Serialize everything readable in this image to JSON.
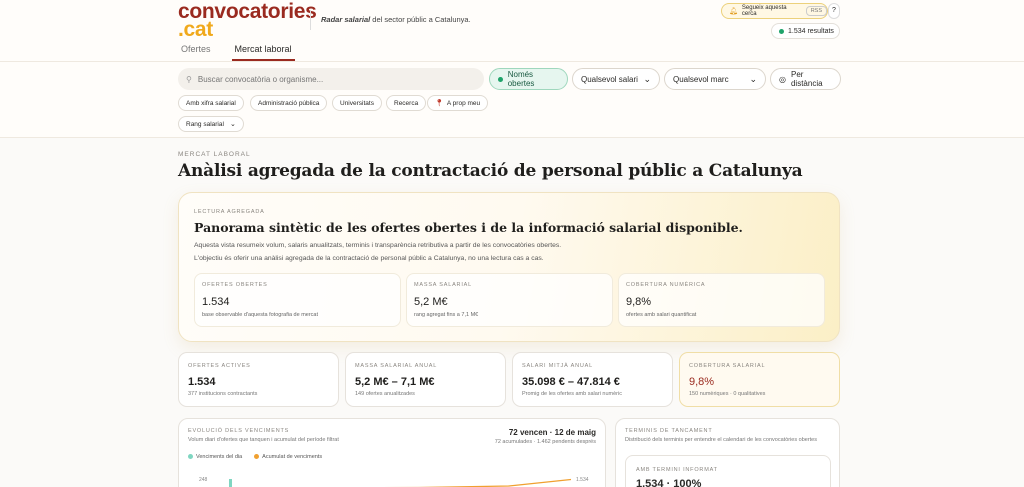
{
  "header": {
    "logo_top": "convocatories",
    "logo_bottom": ".cat",
    "tagline_bold": "Radar salarial",
    "tagline_rest": " del sector públic a Catalunya.",
    "tabs": [
      {
        "label": "Ofertes"
      },
      {
        "label": "Mercat laboral"
      }
    ],
    "follow_label": "Segueix aquesta cerca",
    "rss_label": "RSS",
    "help_label": "?",
    "results_label": "1.534 resultats"
  },
  "filters": {
    "search_placeholder": "Buscar convocatòria o organisme...",
    "only_open": "Només obertes",
    "salary_select": "Qualsevol salari",
    "mark_select": "Qualsevol marc",
    "distance": "Per distància",
    "chips": [
      "Amb xifra salarial",
      "Administració pública",
      "Universitats",
      "Recerca",
      "A prop meu"
    ],
    "salary_range": "Rang salarial"
  },
  "main": {
    "kicker": "MERCAT LABORAL",
    "title": "Anàlisi agregada de la contractació de personal públic a Catalunya"
  },
  "hero": {
    "kicker": "LECTURA AGREGADA",
    "title": "Panorama sintètic de les ofertes obertes i de la informació salarial disponible.",
    "desc1": "Aquesta vista resumeix volum, salaris anualitzats, terminis i transparència retributiva a partir de les convocatòries obertes.",
    "desc2": "L'objectiu és oferir una anàlisi agregada de la contractació de personal públic a Catalunya, no una lectura cas a cas.",
    "metrics": [
      {
        "label": "OFERTES OBERTES",
        "value": "1.534",
        "sub": "base observable d'aquesta fotografia de mercat"
      },
      {
        "label": "MASSA SALARIAL",
        "value": "5,2 M€",
        "sub": "rang agregat fins a 7,1 M€"
      },
      {
        "label": "COBERTURA NUMÈRICA",
        "value": "9,8%",
        "sub": "ofertes amb salari quantificat"
      }
    ]
  },
  "cards": [
    {
      "label": "OFERTES ACTIVES",
      "value": "1.534",
      "sub": "377 institucions contractants"
    },
    {
      "label": "MASSA SALARIAL ANUAL",
      "value": "5,2 M€ – 7,1 M€",
      "sub": "149 ofertes anualitzades"
    },
    {
      "label": "SALARI MITJÀ ANUAL",
      "value": "35.098 € – 47.814 €",
      "sub": "Promig de les ofertes amb salari numèric"
    },
    {
      "label": "COBERTURA SALARIAL",
      "value": "9,8%",
      "sub": "150 numèriques · 0 qualitatives"
    }
  ],
  "expiry_panel": {
    "label": "EVOLUCIÓ DELS VENCIMENTS",
    "sub": "Volum diari d'ofertes que tanquen i acumulat del període filtrat",
    "right_head": "72 vencen · 12 de maig",
    "right_sub": "72 acumulades · 1.462 pendents després",
    "legend_daily": "Venciments del dia",
    "legend_cumulative": "Acumulat de venciments",
    "y_left": "248",
    "y_right": "1.534"
  },
  "deadline_panel": {
    "label": "TERMINIS DE TANCAMENT",
    "sub": "Distribució dels terminis per entendre el calendari de les convocatòries obertes",
    "inner_label": "AMB TERMINI INFORMAT",
    "inner_value": "1.534 · 100%"
  },
  "colors": {
    "brand_red": "#9a2a1f",
    "brand_gold": "#f0a91c",
    "green": "#1ea36a",
    "teal": "#7fd6c1",
    "orange": "#f0a030"
  }
}
